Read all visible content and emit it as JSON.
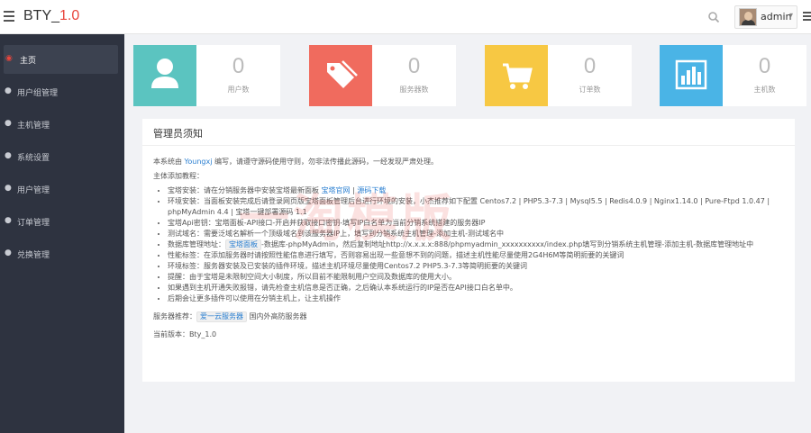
{
  "header": {
    "brand": "BTY_",
    "brand_version": "1.0",
    "user_name": "admin",
    "caret": "▾"
  },
  "sidebar": {
    "items": [
      {
        "label": "主页",
        "icon": "dashboard-icon",
        "glyph": "◉",
        "active": true
      },
      {
        "label": "用户组管理",
        "icon": "map-marker-icon",
        "glyph": "●"
      },
      {
        "label": "主机管理",
        "icon": "map-marker-icon",
        "glyph": "●"
      },
      {
        "label": "系统设置",
        "icon": "map-marker-icon",
        "glyph": "●"
      },
      {
        "label": "用户管理",
        "icon": "map-marker-icon",
        "glyph": "●"
      },
      {
        "label": "订单管理",
        "icon": "map-marker-icon",
        "glyph": "●"
      },
      {
        "label": "兑换管理",
        "icon": "map-marker-icon",
        "glyph": "●"
      }
    ]
  },
  "stats": [
    {
      "value": "0",
      "label": "用户数",
      "color": "#5bc4c0",
      "icon": "user-icon"
    },
    {
      "value": "0",
      "label": "服务器数",
      "color": "#f06b5e",
      "icon": "tag-icon"
    },
    {
      "value": "0",
      "label": "订单数",
      "color": "#f7c843",
      "icon": "cart-icon"
    },
    {
      "value": "0",
      "label": "主机数",
      "color": "#4ab4e6",
      "icon": "bar-chart-icon"
    }
  ],
  "notice": {
    "title": "管理员须知",
    "intro_pre": "本系统由 ",
    "intro_author": "Youngxj",
    "intro_post": " 编写，请遵守源码使用守则，勿非法传播此源码，一经发现严肃处理。",
    "tutorial_heading": "主体添加教程：",
    "items": [
      {
        "pre": "宝塔安装：请在分销服务器中安装宝塔最新面板 ",
        "link1": "宝塔官网",
        "sep": " | ",
        "link2": "源码下载"
      },
      {
        "text": "环境安装：当面板安装完成后请登录网页版宝塔面板管理后台进行环境的安装，小杰推荐如下配置 Centos7.2 | PHP5.3-7.3 | Mysql5.5 | Redis4.0.9 | Nginx1.14.0 | Pure-Ftpd 1.0.47 | phpMyAdmin 4.4 | 宝塔一键部署源码 1.1"
      },
      {
        "text": "宝塔Api密钥：宝塔面板-API接口-开启并获取接口密钥-填写IP白名单为当前分销系统搭建的服务器IP"
      },
      {
        "text": "测试域名：需要泛域名解析一个顶级域名到该服务器IP上，填写到分销系统主机管理-添加主机-测试域名中"
      },
      {
        "pre": "数据库管理地址：",
        "badge": "宝塔面板",
        "post": "-数据库-phpMyAdmin，然后复制地址http://x.x.x.x:888/phpmyadmin_xxxxxxxxxx/index.php填写到分销系统主机管理-添加主机-数据库管理地址中"
      },
      {
        "text": "性能标签：在添加服务器时请按照性能信息进行填写，否则容易出现一些意想不到的问题，描述主机性能尽量使用2G4H6M等简明扼要的关键词"
      },
      {
        "text": "环境标签：服务器安装及已安装的插件环境，描述主机环境尽量使用Centos7.2 PHP5.3-7.3等简明扼要的关键词"
      },
      {
        "text": "提醒：由于宝塔是未限制空间大小制度，所以目前不能限制用户空间及数据库的使用大小。"
      },
      {
        "text": "如果遇到主机开通失败报错，请先检查主机信息是否正确，之后确认本系统运行的IP是否在API接口白名单中。"
      },
      {
        "text": "后期会让更多插件可以使用在分销主机上，让主机操作"
      }
    ],
    "recommend_pre": "服务器推荐：",
    "recommend_badge": "爱一云服务器",
    "recommend_post": " 国内外高防服务器",
    "version_label": "当前版本：Bty_1.0"
  },
  "watermark": "一淘模版"
}
